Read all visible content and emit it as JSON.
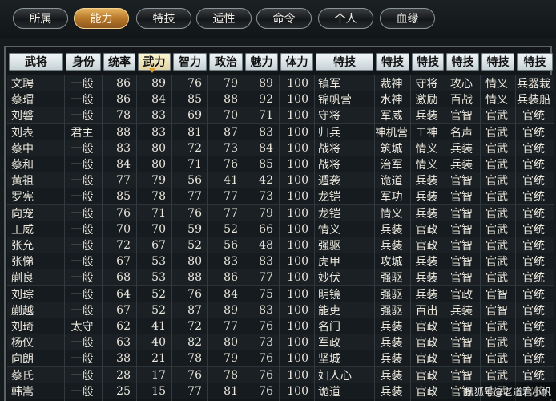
{
  "tabs": [
    {
      "label": "所属",
      "active": false
    },
    {
      "label": "能力",
      "active": true
    },
    {
      "label": "特技",
      "active": false
    },
    {
      "label": "适性",
      "active": false
    },
    {
      "label": "命令",
      "active": false
    },
    {
      "label": "个人",
      "active": false
    },
    {
      "label": "血缘",
      "active": false
    }
  ],
  "table": {
    "sorted_by": "武力",
    "columns": [
      "武将",
      "身份",
      "统率",
      "武力",
      "智力",
      "政治",
      "魅力",
      "体力",
      "特技",
      "特技",
      "特技",
      "特技",
      "特技",
      "特技"
    ],
    "rows": [
      [
        "文聘",
        "一般",
        "86",
        "89",
        "76",
        "79",
        "89",
        "100",
        "镇军",
        "裁神",
        "守将",
        "攻心",
        "情义",
        "兵器栽"
      ],
      [
        "蔡瑁",
        "一般",
        "86",
        "84",
        "85",
        "88",
        "92",
        "100",
        "锦帆营",
        "水神",
        "激励",
        "百战",
        "情义",
        "兵装船"
      ],
      [
        "刘磐",
        "一般",
        "78",
        "83",
        "69",
        "70",
        "71",
        "100",
        "守将",
        "军威",
        "兵装",
        "官智",
        "官武",
        "官统"
      ],
      [
        "刘表",
        "君主",
        "88",
        "83",
        "81",
        "87",
        "83",
        "100",
        "归兵",
        "神机营",
        "工神",
        "名声",
        "官武",
        "官统"
      ],
      [
        "蔡中",
        "一般",
        "83",
        "80",
        "72",
        "73",
        "84",
        "100",
        "战将",
        "筑城",
        "情义",
        "兵装",
        "官武",
        "官统"
      ],
      [
        "蔡和",
        "一般",
        "84",
        "80",
        "71",
        "76",
        "85",
        "100",
        "战将",
        "治军",
        "情义",
        "兵装",
        "官武",
        "官统"
      ],
      [
        "黄祖",
        "一般",
        "77",
        "79",
        "56",
        "41",
        "42",
        "100",
        "遁袭",
        "诡道",
        "兵装",
        "官智",
        "官武",
        "官统"
      ],
      [
        "罗宪",
        "一般",
        "85",
        "78",
        "77",
        "77",
        "73",
        "100",
        "龙铠",
        "军功",
        "兵装",
        "官智",
        "官武",
        "官统"
      ],
      [
        "向宠",
        "一般",
        "76",
        "71",
        "76",
        "77",
        "79",
        "100",
        "龙铠",
        "情义",
        "兵装",
        "官智",
        "官武",
        "官统"
      ],
      [
        "王威",
        "一般",
        "70",
        "70",
        "59",
        "52",
        "66",
        "100",
        "情义",
        "兵装",
        "官政",
        "官智",
        "官武",
        "官统"
      ],
      [
        "张允",
        "一般",
        "72",
        "67",
        "52",
        "56",
        "48",
        "100",
        "强驱",
        "兵装",
        "官政",
        "官智",
        "官武",
        "官统"
      ],
      [
        "张悌",
        "一般",
        "67",
        "53",
        "80",
        "83",
        "83",
        "100",
        "虎甲",
        "攻城",
        "兵装",
        "官智",
        "官武",
        "官统"
      ],
      [
        "蒯良",
        "一般",
        "68",
        "53",
        "88",
        "86",
        "77",
        "100",
        "妙伏",
        "强驱",
        "兵装",
        "官智",
        "官武",
        "官统"
      ],
      [
        "刘琮",
        "一般",
        "64",
        "52",
        "76",
        "84",
        "75",
        "100",
        "明镜",
        "强驱",
        "兵装",
        "官政",
        "官智",
        "官统"
      ],
      [
        "蒯越",
        "一般",
        "67",
        "52",
        "87",
        "89",
        "83",
        "100",
        "能吏",
        "强驱",
        "百出",
        "兵装",
        "官智",
        "官统"
      ],
      [
        "刘琦",
        "太守",
        "62",
        "41",
        "72",
        "77",
        "76",
        "100",
        "名门",
        "兵装",
        "官政",
        "官智",
        "官武",
        "官统"
      ],
      [
        "杨仪",
        "一般",
        "63",
        "40",
        "82",
        "80",
        "73",
        "100",
        "军政",
        "兵装",
        "官政",
        "官智",
        "官武",
        "官统"
      ],
      [
        "向朗",
        "一般",
        "38",
        "21",
        "78",
        "79",
        "76",
        "100",
        "坚城",
        "兵装",
        "官政",
        "官智",
        "官武",
        "官统"
      ],
      [
        "蔡氏",
        "一般",
        "28",
        "17",
        "76",
        "78",
        "76",
        "100",
        "妇人心",
        "兵装",
        "官政",
        "官智",
        "官武",
        "官统"
      ],
      [
        "韩嵩",
        "一般",
        "25",
        "15",
        "77",
        "81",
        "76",
        "100",
        "诡道",
        "兵装",
        "官政",
        "官智",
        "官武",
        "官统"
      ]
    ]
  },
  "watermark": "搜狐号@老道君小帆"
}
